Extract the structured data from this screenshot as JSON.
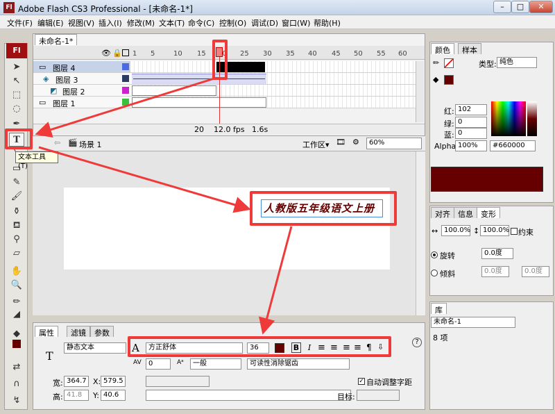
{
  "window": {
    "title": "Adobe Flash CS3 Professional - [未命名-1*]",
    "logo": "Fl",
    "min": "–",
    "max": "□",
    "close": "✕"
  },
  "menu": [
    "文件(F)",
    "编辑(E)",
    "视图(V)",
    "插入(I)",
    "修改(M)",
    "文本(T)",
    "命令(C)",
    "控制(O)",
    "调试(D)",
    "窗口(W)",
    "帮助(H)"
  ],
  "doc_tab": "未命名-1*",
  "timeline": {
    "frame_numbers": [
      "1",
      "5",
      "10",
      "15",
      "20",
      "25",
      "30",
      "35",
      "40",
      "45",
      "50",
      "55",
      "60"
    ],
    "layers": [
      {
        "name": "图层 4"
      },
      {
        "name": "图层 3"
      },
      {
        "name": "图层 2"
      },
      {
        "name": "图层 1"
      }
    ],
    "status": {
      "frame": "20",
      "fps": "12.0 fps",
      "time": "1.6s"
    }
  },
  "stagebar": {
    "scene": "场景 1",
    "workspace": "工作区▾",
    "zoom": "60%"
  },
  "tooltip": "文本工具 (T)",
  "stage_text": "人教版五年级语文上册",
  "properties": {
    "tabs": [
      "属性",
      "滤镜",
      "参数"
    ],
    "text_type": "静态文本",
    "font": "方正舒体",
    "size": "36",
    "spacing_val": "0",
    "char_pos": "一般",
    "antialias": "可读性消除锯齿",
    "w_label": "宽:",
    "w": "364.7",
    "x_label": "X:",
    "x": "579.5",
    "h_label": "高:",
    "h": "41.8",
    "y_label": "Y:",
    "y": "40.6",
    "auto_kern": "自动调整字距",
    "target_label": "目标:",
    "bold": "B",
    "italic": "I",
    "help": "?"
  },
  "color_panel": {
    "tabs": [
      "颜色",
      "样本"
    ],
    "type_label": "类型:",
    "type": "纯色",
    "r_label": "红:",
    "r": "102",
    "g_label": "绿:",
    "g": "0",
    "b_label": "蓝:",
    "b": "0",
    "alpha_label": "Alpha:",
    "alpha": "100%",
    "hex": "#660000",
    "swatch_color": "#660000"
  },
  "transform_panel": {
    "tabs": [
      "对齐",
      "信息",
      "变形"
    ],
    "w": "100.0%",
    "h": "100.0%",
    "constrain": "约束",
    "rotate": "旋转",
    "rot_val": "0.0度",
    "skew": "倾斜",
    "skew1": "0.0度",
    "skew2": "0.0度"
  },
  "library": {
    "tab": "库",
    "doc": "未命名-1",
    "count": "8 项"
  }
}
